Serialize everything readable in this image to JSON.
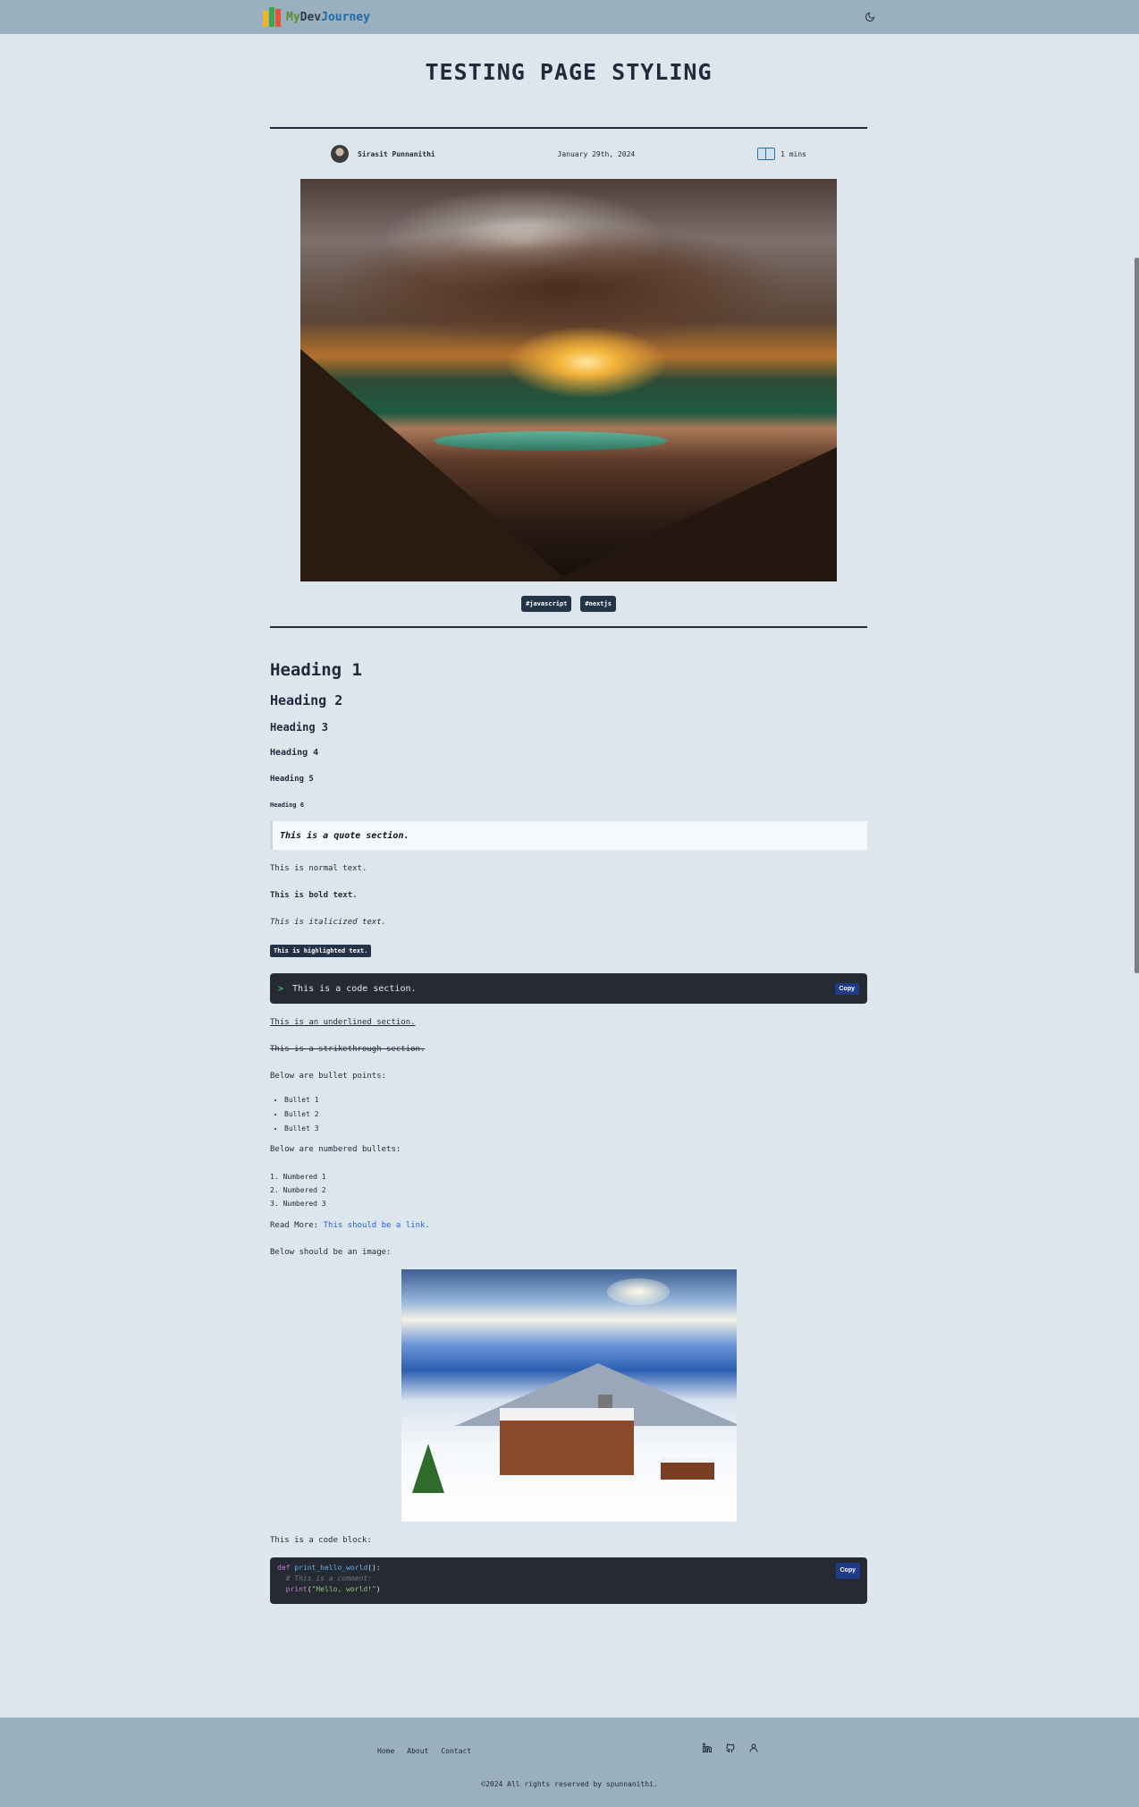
{
  "brand": {
    "my": "My",
    "dev": "Dev",
    "journey": "Journey"
  },
  "page_title": "TESTING PAGE STYLING",
  "meta": {
    "author": "Sirasit Punnanithi",
    "date": "January 29th, 2024",
    "read_time": "1 mins"
  },
  "tags": [
    "#javascript",
    "#nextjs"
  ],
  "headings": [
    "Heading 1",
    "Heading 2",
    "Heading 3",
    "Heading 4",
    "Heading 5",
    "Heading 6"
  ],
  "quote": "This is a quote section.",
  "normal_text": "This is normal text.",
  "bold_text": "This is bold text.",
  "italic_text": "This is italicized text.",
  "highlight_text": "This is highlighted text.",
  "code_section": {
    "prompt": ">",
    "text": "This is a code section.",
    "copy_label": "Copy"
  },
  "underlined_text": "This is an underlined section.",
  "strike_text": "This is a strikethrough section.",
  "bullets_intro": "Below are bullet points:",
  "bullets": [
    "Bullet 1",
    "Bullet 2",
    "Bullet 3"
  ],
  "numbered_intro": "Below are numbered bullets:",
  "numbered": [
    "1.  Numbered 1",
    "2.  Numbered 2",
    "3.  Numbered 3"
  ],
  "read_more": {
    "label": "Read More: ",
    "link": "This should be a link."
  },
  "image_intro": "Below should be an image:",
  "code_block_intro": "This is a code block:",
  "code_block": {
    "copy_label": "Copy",
    "line1_kw": "def ",
    "line1_fn": "print_hello_world",
    "line1_rest": "():",
    "line2": "  # This is a comment:",
    "line3_fn": "  print",
    "line3_open": "(",
    "line3_str": "\"Hello, world!\"",
    "line3_close": ")"
  },
  "footer": {
    "nav": [
      "Home",
      "About",
      "Contact"
    ],
    "copyright": "©2024 All rights reserved by spunnanithi."
  },
  "icons": {
    "theme": "moon-icon",
    "read_time": "book-icon",
    "socials": [
      "linkedin-icon",
      "github-icon",
      "user-icon"
    ]
  },
  "colors": {
    "page_bg": "#dde5ed",
    "header_bg": "#9ab0bf",
    "text_dark": "#1f2a3c",
    "code_bg": "#262b33",
    "copy_button": "#1e3a8a",
    "link": "#2563eb"
  }
}
